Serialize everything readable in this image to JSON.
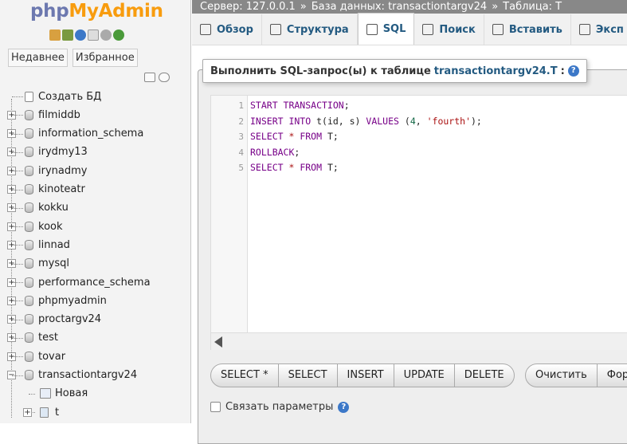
{
  "logo": {
    "php": "php",
    "admin": "MyAdmin"
  },
  "left_tabs": [
    "Недавнее",
    "Избранное"
  ],
  "tree": [
    {
      "label": "Создать БД",
      "type": "new"
    },
    {
      "label": "filmiddb",
      "type": "db"
    },
    {
      "label": "information_schema",
      "type": "db"
    },
    {
      "label": "irydmy13",
      "type": "db"
    },
    {
      "label": "irynadmy",
      "type": "db"
    },
    {
      "label": "kinoteatr",
      "type": "db"
    },
    {
      "label": "kokku",
      "type": "db"
    },
    {
      "label": "kook",
      "type": "db"
    },
    {
      "label": "linnad",
      "type": "db"
    },
    {
      "label": "mysql",
      "type": "db"
    },
    {
      "label": "performance_schema",
      "type": "db"
    },
    {
      "label": "phpmyadmin",
      "type": "db"
    },
    {
      "label": "proctargv24",
      "type": "db"
    },
    {
      "label": "test",
      "type": "db"
    },
    {
      "label": "tovar",
      "type": "db"
    },
    {
      "label": "transactiontargv24",
      "type": "db-open"
    },
    {
      "label": "Новая",
      "type": "new-table"
    },
    {
      "label": "t",
      "type": "table"
    }
  ],
  "breadcrumb": {
    "server": "Сервер: 127.0.0.1",
    "database": "База данных: transactiontargv24",
    "table": "Таблица: T"
  },
  "tabs": [
    {
      "label": "Обзор",
      "icon": "browse-icon"
    },
    {
      "label": "Структура",
      "icon": "structure-icon"
    },
    {
      "label": "SQL",
      "icon": "sql-icon",
      "active": true
    },
    {
      "label": "Поиск",
      "icon": "search-icon"
    },
    {
      "label": "Вставить",
      "icon": "insert-icon"
    },
    {
      "label": "Эксп",
      "icon": "export-icon"
    }
  ],
  "legend": {
    "prefix": "Выполнить SQL-запрос(ы) к таблице",
    "table": "transactiontargv24.T",
    "suffix": ":"
  },
  "code_lines": [
    [
      {
        "t": "START TRANSACTION",
        "c": "kw"
      },
      {
        "t": ";",
        "c": "plain"
      }
    ],
    [
      {
        "t": "INSERT INTO ",
        "c": "kw"
      },
      {
        "t": "t(id, s) ",
        "c": "plain"
      },
      {
        "t": "VALUES ",
        "c": "kw"
      },
      {
        "t": "(",
        "c": "plain"
      },
      {
        "t": "4",
        "c": "num"
      },
      {
        "t": ", ",
        "c": "plain"
      },
      {
        "t": "'fourth'",
        "c": "str"
      },
      {
        "t": ");",
        "c": "plain"
      }
    ],
    [
      {
        "t": "SELECT ",
        "c": "kw"
      },
      {
        "t": "* ",
        "c": "op"
      },
      {
        "t": "FROM ",
        "c": "kw"
      },
      {
        "t": "T;",
        "c": "plain"
      }
    ],
    [
      {
        "t": "ROLLBACK",
        "c": "kw"
      },
      {
        "t": ";",
        "c": "plain"
      }
    ],
    [
      {
        "t": "SELECT ",
        "c": "kw"
      },
      {
        "t": "* ",
        "c": "op"
      },
      {
        "t": "FROM ",
        "c": "kw"
      },
      {
        "t": "T;",
        "c": "plain"
      }
    ]
  ],
  "line_numbers": [
    "1",
    "2",
    "3",
    "4",
    "5"
  ],
  "buttons1": [
    "SELECT *",
    "SELECT",
    "INSERT",
    "UPDATE",
    "DELETE"
  ],
  "buttons2": [
    "Очистить",
    "Форм"
  ],
  "bind_params": "Связать параметры",
  "help_glyph": "?"
}
